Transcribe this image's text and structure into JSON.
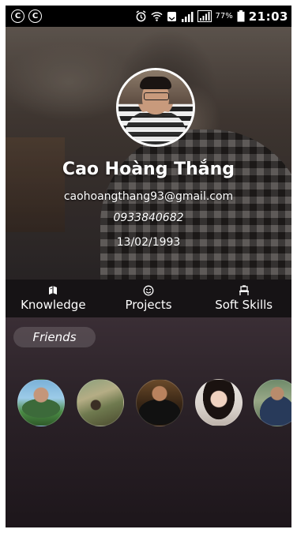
{
  "status_bar": {
    "left_icons": [
      "c-circle-icon",
      "c-circle-icon"
    ],
    "left_glyphs": [
      "C",
      "C"
    ],
    "battery_percent": "77%",
    "time": "21:03"
  },
  "profile": {
    "name": "Cao Hoàng Thắng",
    "email": "caohoangthang93@gmail.com",
    "phone": "0933840682",
    "birthdate": "13/02/1993"
  },
  "tabs": [
    {
      "label": "Knowledge",
      "icon": "book-icon"
    },
    {
      "label": "Projects",
      "icon": "smiley-icon"
    },
    {
      "label": "Soft Skills",
      "icon": "chair-icon"
    }
  ],
  "friends": {
    "title": "Friends",
    "count": 5
  },
  "colors": {
    "tab_bar": "#141213",
    "content_bg": "#2b2228",
    "text": "#ffffff"
  }
}
